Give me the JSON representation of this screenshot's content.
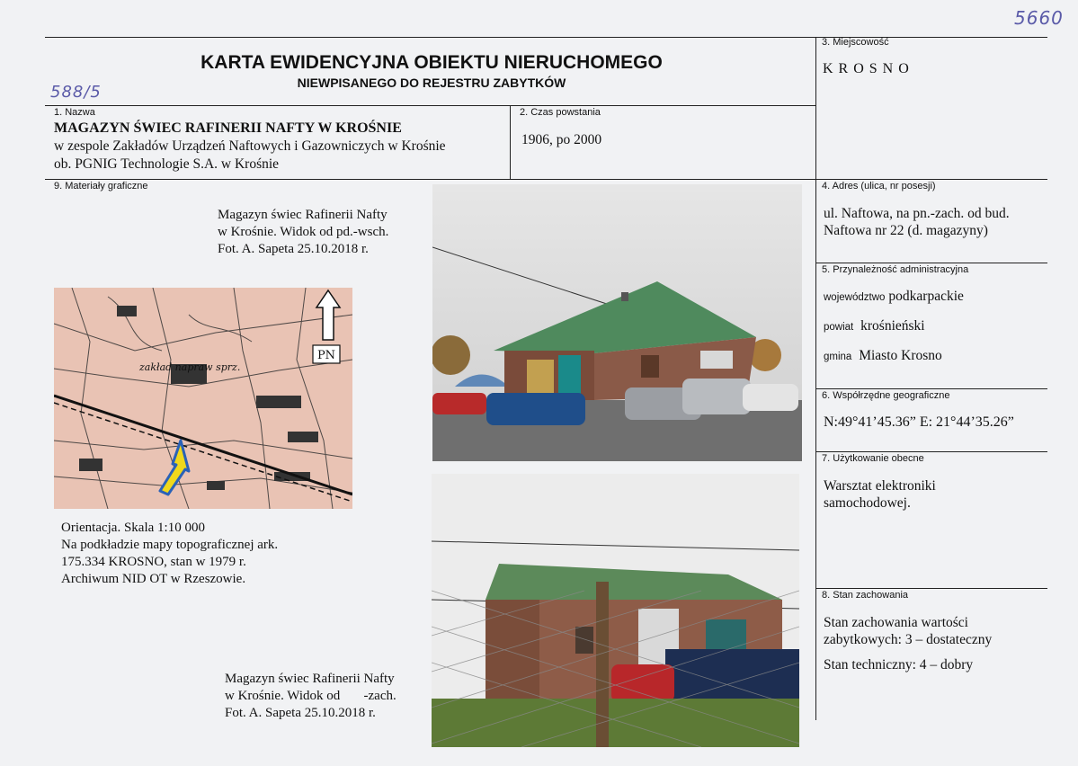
{
  "handwritten": {
    "corner_number": "5660",
    "side_number": "588/5"
  },
  "header": {
    "title": "KARTA EWIDENCYJNA OBIEKTU NIERUCHOMEGO",
    "subtitle": "NIEWPISANEGO DO REJESTRU ZABYTKÓW"
  },
  "fields": {
    "locality": {
      "label": "3. Miejscowość",
      "value": "K R O S N O"
    },
    "name": {
      "label": "1. Nazwa",
      "title": "MAGAZYN ŚWIEC RAFINERII NAFTY W KROŚNIE",
      "line2": "w zespole Zakładów Urządzeń Naftowych i Gazowniczych w  Krośnie",
      "line3": "ob. PGNIG Technologie S.A. w Krośnie"
    },
    "created": {
      "label": "2. Czas powstania",
      "value": "1906, po 2000"
    },
    "graphics": {
      "label": "9. Materiały graficzne"
    },
    "address": {
      "label": "4. Adres (ulica, nr posesji)",
      "line1": "ul. Naftowa, na pn.-zach. od bud.",
      "line2": "Naftowa nr 22 (d. magazyny)"
    },
    "admin": {
      "label": "5. Przynależność administracyjna",
      "voiv_label": "województwo",
      "voiv_value": "podkarpackie",
      "county_label": "powiat",
      "county_value": "krośnieński",
      "commune_label": "gmina",
      "commune_value": "Miasto Krosno"
    },
    "coords": {
      "label": "6. Współrzędne geograficzne",
      "value": "N:49°41’45.36” E: 21°44’35.26”"
    },
    "usage": {
      "label": "7. Użytkowanie obecne",
      "line1": "Warsztat elektroniki",
      "line2": "samochodowej."
    },
    "condition": {
      "label": "8. Stan zachowania",
      "line1": "Stan zachowania wartości",
      "line2": "zabytkowych: 3 – dostateczny",
      "line3": "Stan techniczny: 4 – dobry"
    }
  },
  "captions": {
    "photo1": {
      "line1": "Magazyn świec Rafinerii Nafty",
      "line2": "w Krośnie. Widok od pd.-wsch.",
      "line3": "Fot. A. Sapeta 25.10.2018 r."
    },
    "map": {
      "line1": "Orientacja. Skala 1:10 000",
      "line2": "Na podkładzie mapy topograficznej ark.",
      "line3": "175.334 KROSNO, stan w 1979 r.",
      "line4": "Archiwum NID OT w Rzeszowie."
    },
    "photo2": {
      "line1": "Magazyn świec Rafinerii Nafty",
      "line2": "w Krośnie. Widok od       -zach.",
      "line3": "Fot. A. Sapeta 25.10.2018 r."
    }
  },
  "map": {
    "north_label": "PN",
    "map_text": "zakład napraw  sprz."
  },
  "colors": {
    "map_bg": "#e9c3b4",
    "roof": "#5c8a5a",
    "arrow": "#f0d81c",
    "arrow_outline": "#2a62b8"
  }
}
